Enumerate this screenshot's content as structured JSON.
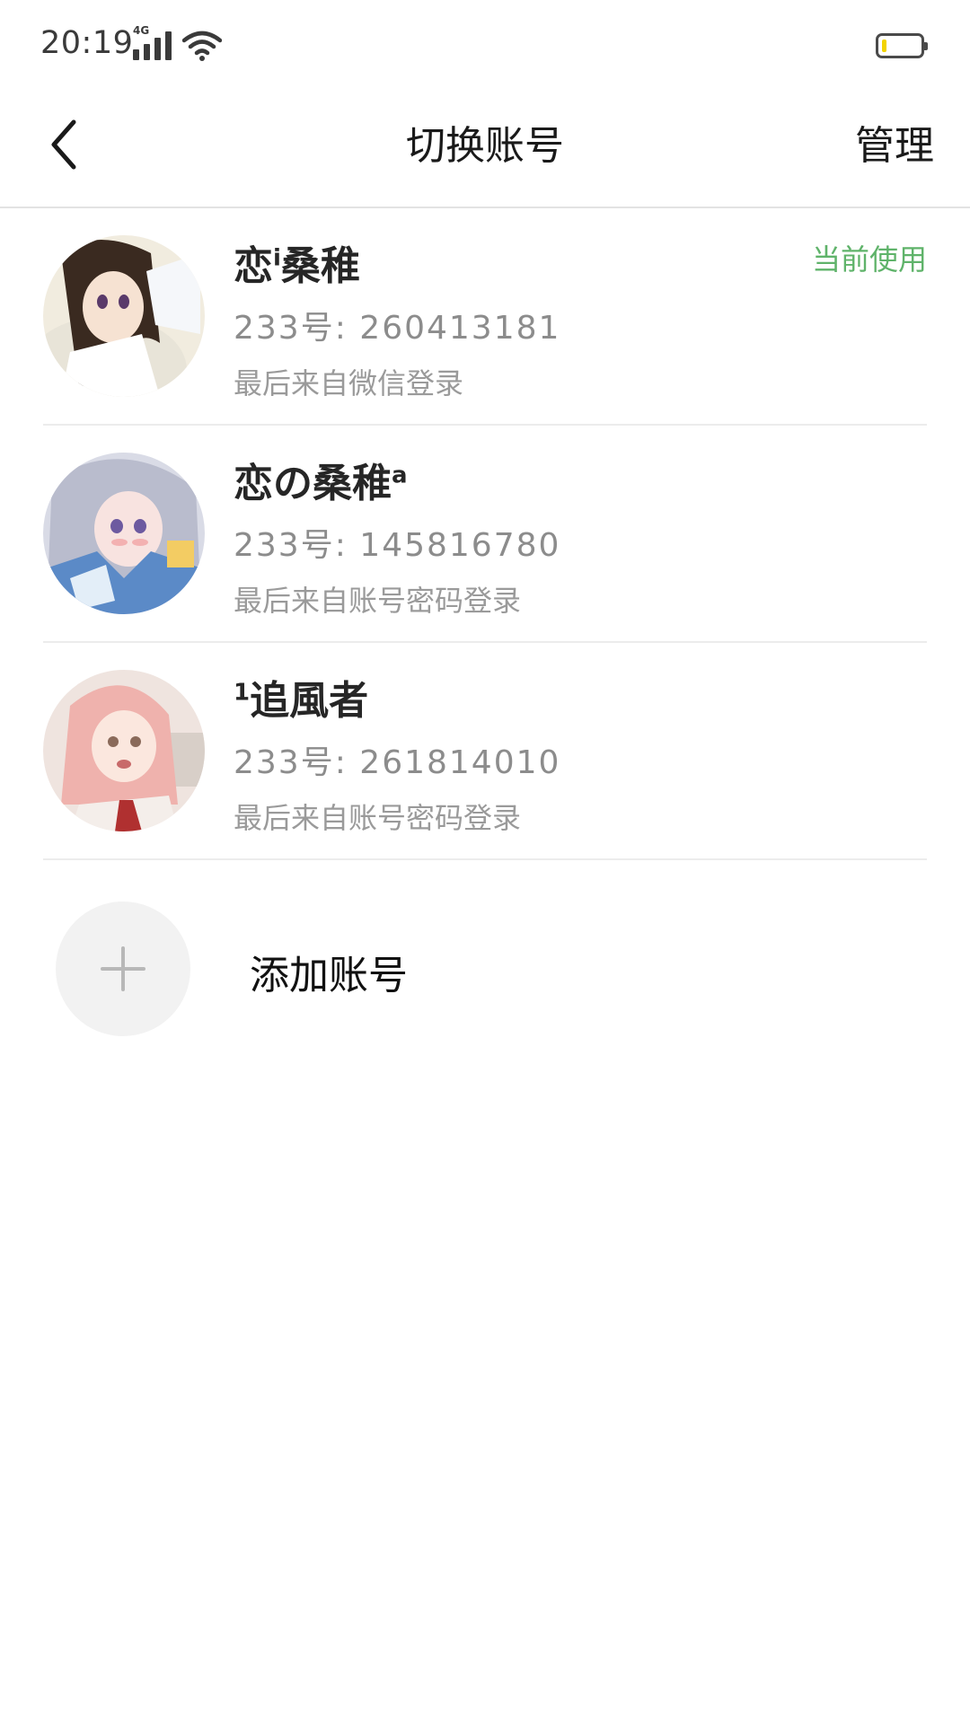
{
  "status_bar": {
    "time": "20:19",
    "network": "4G",
    "battery_level": 0.12,
    "colors": {
      "battery_fill": "#f2d300"
    }
  },
  "header": {
    "title": "切换账号",
    "manage_label": "管理"
  },
  "accounts": [
    {
      "name": "恋",
      "name_sup": "i",
      "name_suffix": "桑稚",
      "id_text": "233号: 260413181",
      "login_text": "最后来自微信登录",
      "current_tag": "当前使用"
    },
    {
      "name": "恋の桑稚",
      "name_sup": "a",
      "name_suffix": "",
      "id_text": "233号: 145816780",
      "login_text": "最后来自账号密码登录",
      "current_tag": ""
    },
    {
      "name": "",
      "name_sup": "1",
      "name_suffix": "追風者",
      "id_text": "233号: 261814010",
      "login_text": "最后来自账号密码登录",
      "current_tag": ""
    }
  ],
  "add_account": {
    "label": "添加账号"
  },
  "colors": {
    "accent_green": "#5fb36a",
    "divider": "#ececec"
  },
  "icons": {
    "back": "chevron-left-icon",
    "add": "plus-icon",
    "wifi": "wifi-icon",
    "signal": "signal-icon",
    "battery": "battery-icon"
  }
}
